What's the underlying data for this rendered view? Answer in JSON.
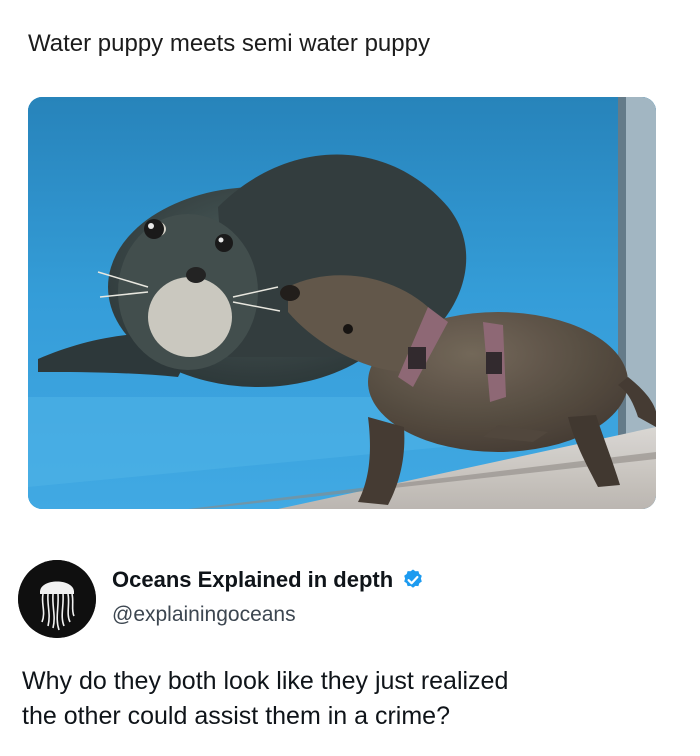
{
  "caption": "Water puppy meets semi water puppy",
  "photo": {
    "subject": "sea-lion-and-otter-photo"
  },
  "tweet": {
    "avatar_icon": "jellyfish-icon",
    "display_name": "Oceans Explained in depth",
    "verified_icon": "verified-badge-icon",
    "verified_color": "#1d9bf0",
    "handle": "@explainingoceans",
    "text_lines": [
      "Why do they both look like they just realized",
      "the other could assist them in a crime?"
    ]
  }
}
